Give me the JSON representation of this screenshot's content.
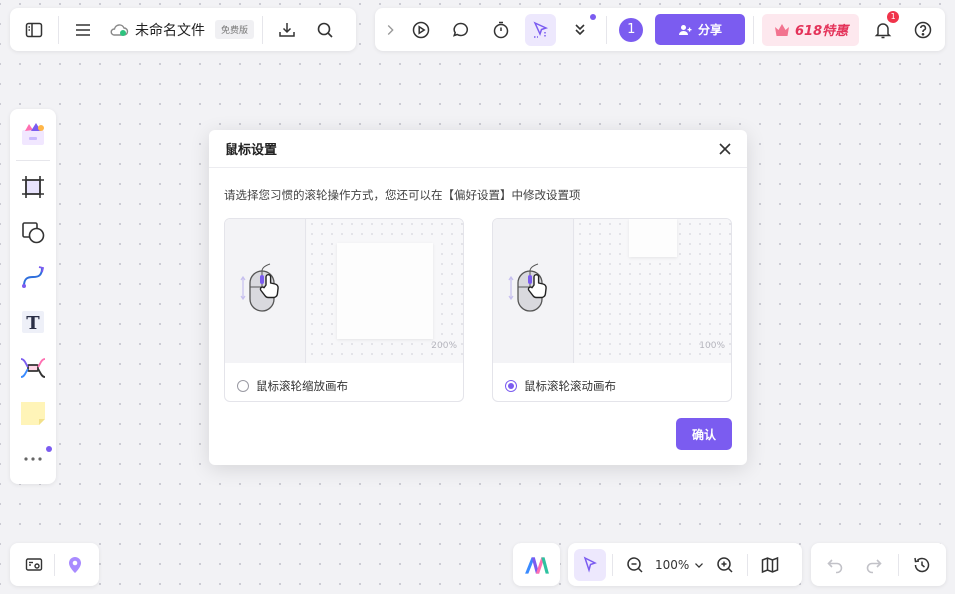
{
  "header": {
    "file_name": "未命名文件",
    "plan_badge": "免费版",
    "collaborator_count": "1",
    "share_label": "分享",
    "promo_label": "618特惠",
    "notification_count": "1"
  },
  "zoom": {
    "level": "100%"
  },
  "modal": {
    "title": "鼠标设置",
    "description": "请选择您习惯的滚轮操作方式，您还可以在【偏好设置】中修改设置项",
    "options": [
      {
        "label": "鼠标滚轮缩放画布",
        "zoom_hint": "200%",
        "selected": false
      },
      {
        "label": "鼠标滚轮滚动画布",
        "zoom_hint": "100%",
        "selected": true
      }
    ],
    "confirm_label": "确认"
  },
  "colors": {
    "accent": "#7b5cf0",
    "promo": "#e4335a",
    "badge_red": "#f0334a"
  },
  "icons": {
    "top_left": [
      "sidebar-toggle-icon",
      "menu-icon",
      "cloud-icon",
      "download-icon",
      "search-icon"
    ],
    "top_right": [
      "chevron-right-icon",
      "play-icon",
      "comment-icon",
      "timer-icon",
      "cursor-select-icon",
      "chevron-double-down-icon",
      "share-user-icon",
      "crown-icon",
      "bell-icon",
      "help-icon"
    ],
    "left_tools": [
      "templates-icon",
      "frame-icon",
      "shape-icon",
      "connector-icon",
      "text-icon",
      "mindmap-icon",
      "sticky-note-icon",
      "more-icon"
    ],
    "bottom": [
      "minimap-icon",
      "location-icon",
      "ai-logo-icon",
      "select-pointer-icon",
      "zoom-out-icon",
      "chevron-down-icon",
      "zoom-in-icon",
      "map-icon",
      "undo-icon",
      "redo-icon",
      "history-icon"
    ]
  }
}
